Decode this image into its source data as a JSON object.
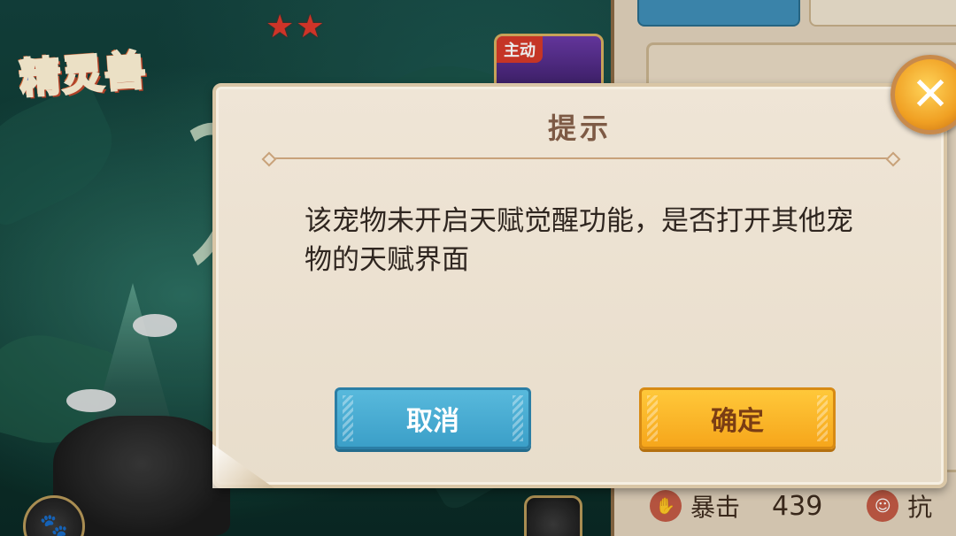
{
  "scene": {
    "logo_text": "精灵兽",
    "stars": "★★",
    "skill_tag": "主动"
  },
  "right_panel": {
    "tab_a": "",
    "tab_b": "",
    "stat_label": "暴击",
    "stat_value": "439",
    "stat_label_2": "抗"
  },
  "dialog": {
    "title": "提示",
    "message": "该宠物未开启天赋觉醒功能，是否打开其他宠物的天赋界面",
    "cancel_label": "取消",
    "confirm_label": "确定",
    "close_symbol": "✕"
  },
  "icons": {
    "close": "close-icon",
    "paw": "paw-icon"
  },
  "colors": {
    "cancel_button": "#3b9fc8",
    "confirm_button": "#f6a61b",
    "dialog_bg": "#efe5d6",
    "title_text": "#7d5a45"
  }
}
